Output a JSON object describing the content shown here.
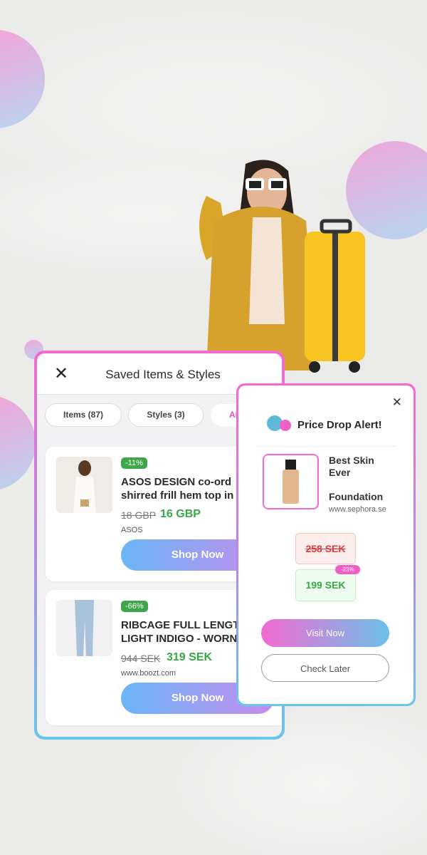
{
  "saved_panel": {
    "title": "Saved Items & Styles",
    "tabs": [
      {
        "label": "Items (87)"
      },
      {
        "label": "Styles (3)"
      },
      {
        "label": "Al"
      }
    ],
    "items": [
      {
        "discount": "-11%",
        "name_line1": "ASOS DESIGN co-ord",
        "name_line2": "shirred frill hem top in",
        "old_price": "18 GBP",
        "new_price": "16 GBP",
        "store": "ASOS",
        "button": "Shop Now"
      },
      {
        "discount": "-66%",
        "name_line1": "RIBCAGE FULL LENGT",
        "name_line2": "LIGHT INDIGO - WORN",
        "old_price": "944 SEK",
        "new_price": "319 SEK",
        "store": "www.boozt.com",
        "button": "Shop Now"
      }
    ]
  },
  "alert": {
    "title": "Price Drop Alert!",
    "product_line1": "Best Skin",
    "product_line2": "Ever",
    "product_line3": "Foundation",
    "store": "www.sephora.se",
    "old_price": "258 SEK",
    "new_price": "199 SEK",
    "discount": "-23%",
    "visit_button": "Visit Now",
    "later_button": "Check Later"
  },
  "colors": {
    "pink": "#f76ad0",
    "blue": "#6bc6ea",
    "green": "#36a844",
    "red": "#e03a3a"
  }
}
